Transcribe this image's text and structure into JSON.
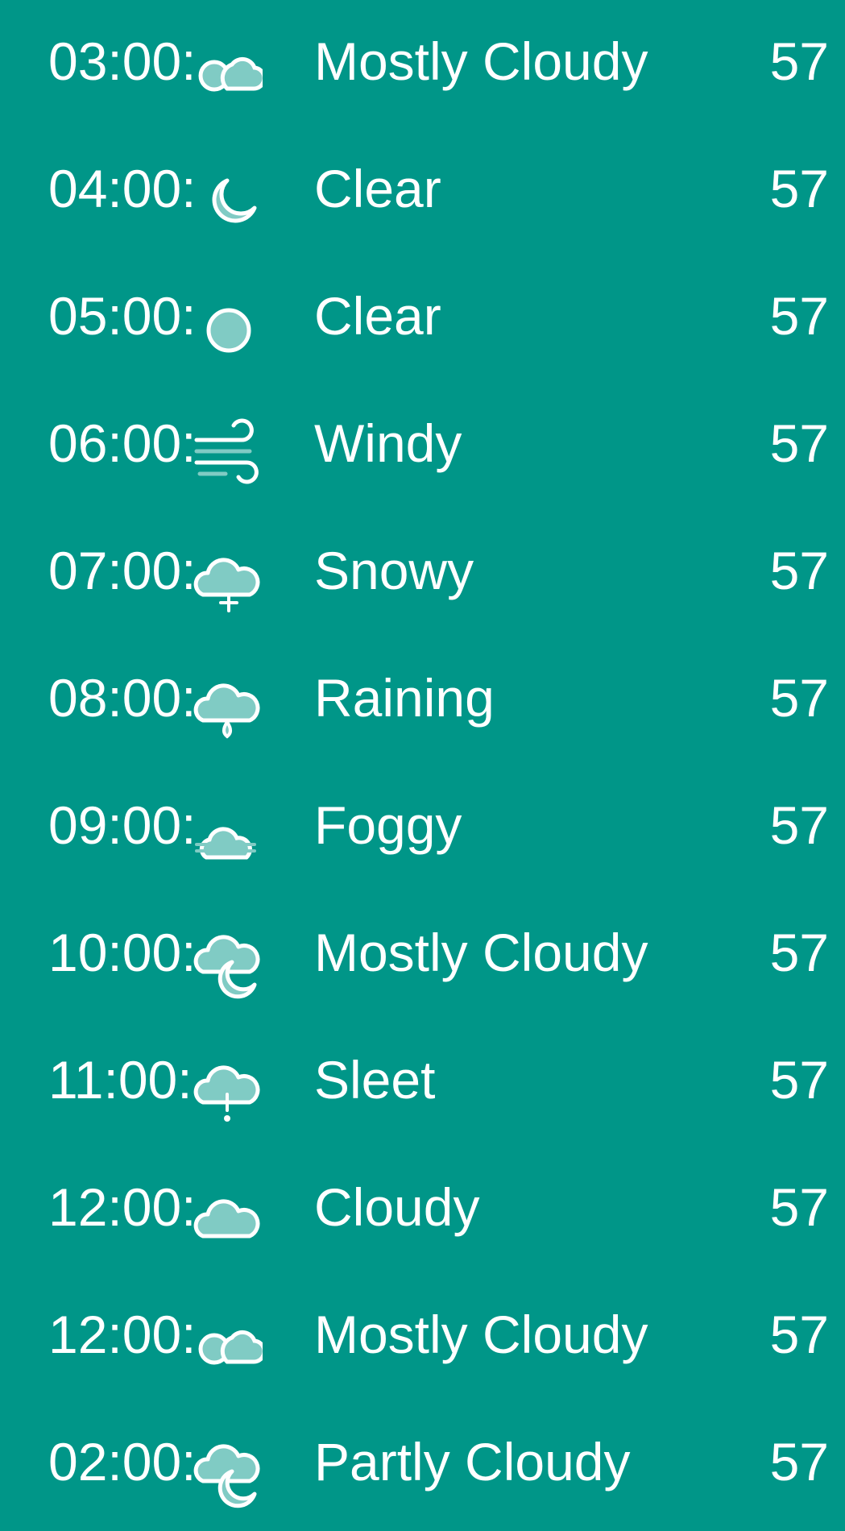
{
  "colors": {
    "background": "#009688",
    "text": "#ffffff",
    "icon_fill": "#80cbc4",
    "icon_stroke": "#ffffff"
  },
  "rows": [
    {
      "time": "03:00:",
      "icon": "mostly-cloudy-icon",
      "condition": "Mostly Cloudy",
      "temp": "57"
    },
    {
      "time": "04:00:",
      "icon": "moon-icon",
      "condition": "Clear",
      "temp": "57"
    },
    {
      "time": "05:00:",
      "icon": "sun-icon",
      "condition": "Clear",
      "temp": "57"
    },
    {
      "time": "06:00:",
      "icon": "wind-icon",
      "condition": "Windy",
      "temp": "57"
    },
    {
      "time": "07:00:",
      "icon": "snow-icon",
      "condition": "Snowy",
      "temp": "57"
    },
    {
      "time": "08:00:",
      "icon": "rain-icon",
      "condition": "Raining",
      "temp": "57"
    },
    {
      "time": "09:00:",
      "icon": "fog-icon",
      "condition": "Foggy",
      "temp": "57"
    },
    {
      "time": "10:00:",
      "icon": "cloud-moon-icon",
      "condition": "Mostly Cloudy",
      "temp": "57"
    },
    {
      "time": "11:00:",
      "icon": "sleet-icon",
      "condition": "Sleet",
      "temp": "57"
    },
    {
      "time": "12:00:",
      "icon": "cloud-icon",
      "condition": "Cloudy",
      "temp": "57"
    },
    {
      "time": "12:00:",
      "icon": "mostly-cloudy-icon",
      "condition": "Mostly Cloudy",
      "temp": "57"
    },
    {
      "time": "02:00:",
      "icon": "cloud-moon-icon",
      "condition": "Partly Cloudy",
      "temp": "57"
    }
  ]
}
